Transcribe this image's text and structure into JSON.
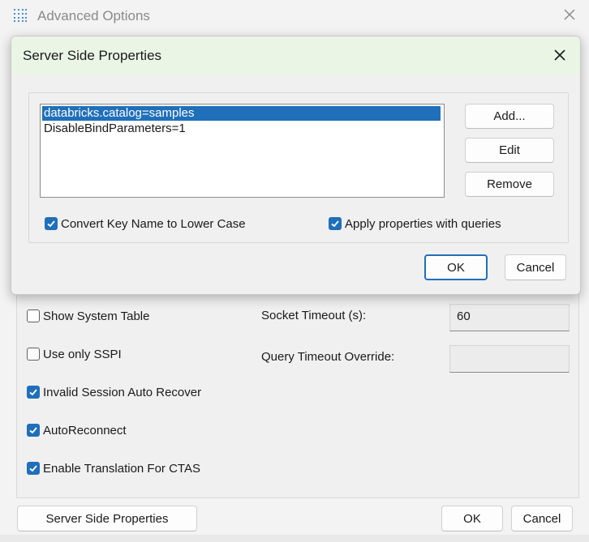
{
  "background_window": {
    "title": "Advanced Options",
    "checkboxes": [
      {
        "label": "Show System Table",
        "checked": false
      },
      {
        "label": "Use only SSPI",
        "checked": false
      },
      {
        "label": "Invalid Session Auto Recover",
        "checked": true
      },
      {
        "label": "AutoReconnect",
        "checked": true
      },
      {
        "label": "Enable Translation For CTAS",
        "checked": true
      }
    ],
    "socket_timeout_label": "Socket Timeout (s):",
    "socket_timeout_value": "60",
    "query_timeout_label": "Query Timeout Override:",
    "query_timeout_value": "",
    "server_side_properties_button": "Server Side Properties",
    "ok_button": "OK",
    "cancel_button": "Cancel"
  },
  "dialog": {
    "title": "Server Side Properties",
    "properties": [
      {
        "text": "databricks.catalog=samples",
        "selected": true
      },
      {
        "text": "DisableBindParameters=1",
        "selected": false
      }
    ],
    "add_button": "Add...",
    "edit_button": "Edit",
    "remove_button": "Remove",
    "convert_lower_label": "Convert Key Name to Lower Case",
    "convert_lower_checked": true,
    "apply_with_queries_label": "Apply properties with queries",
    "apply_with_queries_checked": true,
    "ok_button": "OK",
    "cancel_button": "Cancel"
  },
  "colors": {
    "accent": "#1f6fba",
    "dialog_title_bg": "#eaf5e6"
  },
  "icons": {
    "app": "grid-app-icon",
    "close": "close-icon",
    "check": "checkmark-icon"
  }
}
